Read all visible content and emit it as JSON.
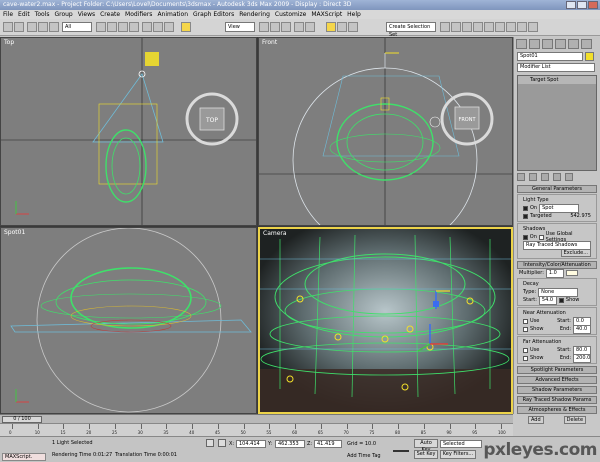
{
  "window": {
    "title": "cave-water2.max  - Project Folder: C:\\Users\\Lovel\\Documents\\3dsmax  - Autodesk 3ds Max  2009  - Display : Direct 3D"
  },
  "menu": [
    "File",
    "Edit",
    "Tools",
    "Group",
    "Views",
    "Create",
    "Modifiers",
    "Animation",
    "Graph Editors",
    "Rendering",
    "Customize",
    "MAXScript",
    "Help"
  ],
  "toolbar": {
    "filter_select": "All",
    "refcoord_select": "View",
    "named_selection": "Create Selection Set"
  },
  "viewports": {
    "top": {
      "label": "Top",
      "cube_label": "TOP"
    },
    "front": {
      "label": "Front",
      "cube_label": "FRONT"
    },
    "spot": {
      "label": "Spot01"
    },
    "camera": {
      "label": "Camera"
    }
  },
  "command_panel": {
    "object_name": "Spot01",
    "modifier_list": "Modifier List",
    "stack_item": "Target Spot",
    "general": {
      "title": "General Parameters",
      "light_type_label": "Light Type",
      "on_label": "On",
      "type_value": "Spot",
      "targeted_label": "Targeted",
      "targeted_value": "542.975",
      "shadows_label": "Shadows",
      "shadows_on_label": "On",
      "use_global_label": "Use Global Settings",
      "shadow_type": "Ray Traced Shadows",
      "exclude_label": "Exclude..."
    },
    "intensity": {
      "title": "Intensity/Color/Attenuation",
      "multiplier_label": "Multiplier:",
      "multiplier_value": "1.0",
      "decay_label": "Decay",
      "type_label": "Type:",
      "type_value": "None",
      "start_label": "Start:",
      "start_value": "54.0",
      "show_label": "Show",
      "near_label": "Near Attenuation",
      "use_label": "Use",
      "near_start_label": "Start:",
      "near_start_value": "0.0",
      "near_end_label": "End:",
      "near_end_value": "40.0",
      "far_label": "Far Attenuation",
      "far_start_label": "Start:",
      "far_start_value": "80.0",
      "far_end_label": "End:",
      "far_end_value": "200.0"
    },
    "rollouts": [
      "Spotlight Parameters",
      "Advanced Effects",
      "Shadow Parameters",
      "Ray Traced Shadow Params",
      "Atmospheres & Effects"
    ],
    "add_label": "Add",
    "delete_label": "Delete"
  },
  "timeline": {
    "slider": "0 / 100",
    "ticks": [
      "0",
      "10",
      "15",
      "20",
      "25",
      "30",
      "35",
      "40",
      "45",
      "50",
      "55",
      "60",
      "65",
      "70",
      "75",
      "80",
      "85",
      "90",
      "95",
      "100"
    ]
  },
  "status": {
    "selection": "1 Light Selected",
    "rendering_time": "Rendering Time  0:01:27",
    "translation_time": "Translation Time  0:00:01",
    "x_label": "X:",
    "x_value": "104.414",
    "y_label": "Y:",
    "y_value": "462.353",
    "z_label": "Z:",
    "z_value": "41.419",
    "grid": "Grid = 10.0",
    "add_time_tag": "Add Time Tag",
    "auto_key": "Auto Key",
    "set_key": "Set Key",
    "selected": "Selected",
    "key_filters": "Key Filters...",
    "maxscript": "MAXScript."
  },
  "watermark": "pxleyes.com",
  "colors": {
    "active_border": "#ecd34a",
    "wireframe": "#3fe06a",
    "light_cone": "#6fbcd8",
    "target_yellow": "#f2df2a"
  }
}
